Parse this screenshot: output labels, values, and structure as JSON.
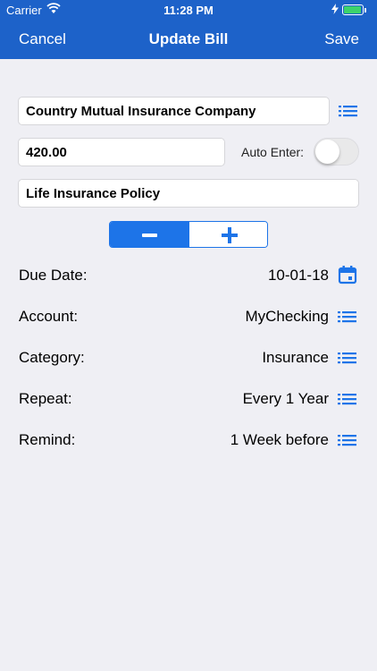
{
  "status_bar": {
    "carrier": "Carrier",
    "time": "11:28 PM"
  },
  "nav": {
    "cancel": "Cancel",
    "title": "Update Bill",
    "save": "Save"
  },
  "form": {
    "payee": "Country Mutual Insurance Company",
    "amount": "420.00",
    "auto_enter_label": "Auto Enter:",
    "auto_enter_on": false,
    "memo": "Life Insurance Policy"
  },
  "sign_toggle": {
    "selected": "minus"
  },
  "details": [
    {
      "label": "Due Date:",
      "value": "10-01-18",
      "icon": "calendar-icon"
    },
    {
      "label": "Account:",
      "value": "MyChecking",
      "icon": "list-icon"
    },
    {
      "label": "Category:",
      "value": "Insurance",
      "icon": "list-icon"
    },
    {
      "label": "Repeat:",
      "value": "Every 1 Year",
      "icon": "list-icon"
    },
    {
      "label": "Remind:",
      "value": "1 Week before",
      "icon": "list-icon"
    }
  ],
  "colors": {
    "nav_bar": "#1d62c9",
    "accent": "#1d74e8",
    "background": "#efeff4"
  }
}
